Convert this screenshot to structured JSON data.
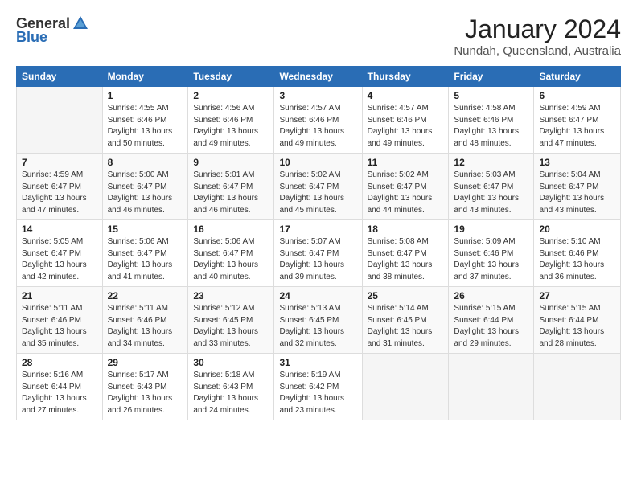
{
  "logo": {
    "general": "General",
    "blue": "Blue"
  },
  "title": "January 2024",
  "location": "Nundah, Queensland, Australia",
  "headers": [
    "Sunday",
    "Monday",
    "Tuesday",
    "Wednesday",
    "Thursday",
    "Friday",
    "Saturday"
  ],
  "weeks": [
    [
      {
        "day": "",
        "info": ""
      },
      {
        "day": "1",
        "info": "Sunrise: 4:55 AM\nSunset: 6:46 PM\nDaylight: 13 hours\nand 50 minutes."
      },
      {
        "day": "2",
        "info": "Sunrise: 4:56 AM\nSunset: 6:46 PM\nDaylight: 13 hours\nand 49 minutes."
      },
      {
        "day": "3",
        "info": "Sunrise: 4:57 AM\nSunset: 6:46 PM\nDaylight: 13 hours\nand 49 minutes."
      },
      {
        "day": "4",
        "info": "Sunrise: 4:57 AM\nSunset: 6:46 PM\nDaylight: 13 hours\nand 49 minutes."
      },
      {
        "day": "5",
        "info": "Sunrise: 4:58 AM\nSunset: 6:46 PM\nDaylight: 13 hours\nand 48 minutes."
      },
      {
        "day": "6",
        "info": "Sunrise: 4:59 AM\nSunset: 6:47 PM\nDaylight: 13 hours\nand 47 minutes."
      }
    ],
    [
      {
        "day": "7",
        "info": "Sunrise: 4:59 AM\nSunset: 6:47 PM\nDaylight: 13 hours\nand 47 minutes."
      },
      {
        "day": "8",
        "info": "Sunrise: 5:00 AM\nSunset: 6:47 PM\nDaylight: 13 hours\nand 46 minutes."
      },
      {
        "day": "9",
        "info": "Sunrise: 5:01 AM\nSunset: 6:47 PM\nDaylight: 13 hours\nand 46 minutes."
      },
      {
        "day": "10",
        "info": "Sunrise: 5:02 AM\nSunset: 6:47 PM\nDaylight: 13 hours\nand 45 minutes."
      },
      {
        "day": "11",
        "info": "Sunrise: 5:02 AM\nSunset: 6:47 PM\nDaylight: 13 hours\nand 44 minutes."
      },
      {
        "day": "12",
        "info": "Sunrise: 5:03 AM\nSunset: 6:47 PM\nDaylight: 13 hours\nand 43 minutes."
      },
      {
        "day": "13",
        "info": "Sunrise: 5:04 AM\nSunset: 6:47 PM\nDaylight: 13 hours\nand 43 minutes."
      }
    ],
    [
      {
        "day": "14",
        "info": "Sunrise: 5:05 AM\nSunset: 6:47 PM\nDaylight: 13 hours\nand 42 minutes."
      },
      {
        "day": "15",
        "info": "Sunrise: 5:06 AM\nSunset: 6:47 PM\nDaylight: 13 hours\nand 41 minutes."
      },
      {
        "day": "16",
        "info": "Sunrise: 5:06 AM\nSunset: 6:47 PM\nDaylight: 13 hours\nand 40 minutes."
      },
      {
        "day": "17",
        "info": "Sunrise: 5:07 AM\nSunset: 6:47 PM\nDaylight: 13 hours\nand 39 minutes."
      },
      {
        "day": "18",
        "info": "Sunrise: 5:08 AM\nSunset: 6:47 PM\nDaylight: 13 hours\nand 38 minutes."
      },
      {
        "day": "19",
        "info": "Sunrise: 5:09 AM\nSunset: 6:46 PM\nDaylight: 13 hours\nand 37 minutes."
      },
      {
        "day": "20",
        "info": "Sunrise: 5:10 AM\nSunset: 6:46 PM\nDaylight: 13 hours\nand 36 minutes."
      }
    ],
    [
      {
        "day": "21",
        "info": "Sunrise: 5:11 AM\nSunset: 6:46 PM\nDaylight: 13 hours\nand 35 minutes."
      },
      {
        "day": "22",
        "info": "Sunrise: 5:11 AM\nSunset: 6:46 PM\nDaylight: 13 hours\nand 34 minutes."
      },
      {
        "day": "23",
        "info": "Sunrise: 5:12 AM\nSunset: 6:45 PM\nDaylight: 13 hours\nand 33 minutes."
      },
      {
        "day": "24",
        "info": "Sunrise: 5:13 AM\nSunset: 6:45 PM\nDaylight: 13 hours\nand 32 minutes."
      },
      {
        "day": "25",
        "info": "Sunrise: 5:14 AM\nSunset: 6:45 PM\nDaylight: 13 hours\nand 31 minutes."
      },
      {
        "day": "26",
        "info": "Sunrise: 5:15 AM\nSunset: 6:44 PM\nDaylight: 13 hours\nand 29 minutes."
      },
      {
        "day": "27",
        "info": "Sunrise: 5:15 AM\nSunset: 6:44 PM\nDaylight: 13 hours\nand 28 minutes."
      }
    ],
    [
      {
        "day": "28",
        "info": "Sunrise: 5:16 AM\nSunset: 6:44 PM\nDaylight: 13 hours\nand 27 minutes."
      },
      {
        "day": "29",
        "info": "Sunrise: 5:17 AM\nSunset: 6:43 PM\nDaylight: 13 hours\nand 26 minutes."
      },
      {
        "day": "30",
        "info": "Sunrise: 5:18 AM\nSunset: 6:43 PM\nDaylight: 13 hours\nand 24 minutes."
      },
      {
        "day": "31",
        "info": "Sunrise: 5:19 AM\nSunset: 6:42 PM\nDaylight: 13 hours\nand 23 minutes."
      },
      {
        "day": "",
        "info": ""
      },
      {
        "day": "",
        "info": ""
      },
      {
        "day": "",
        "info": ""
      }
    ]
  ]
}
